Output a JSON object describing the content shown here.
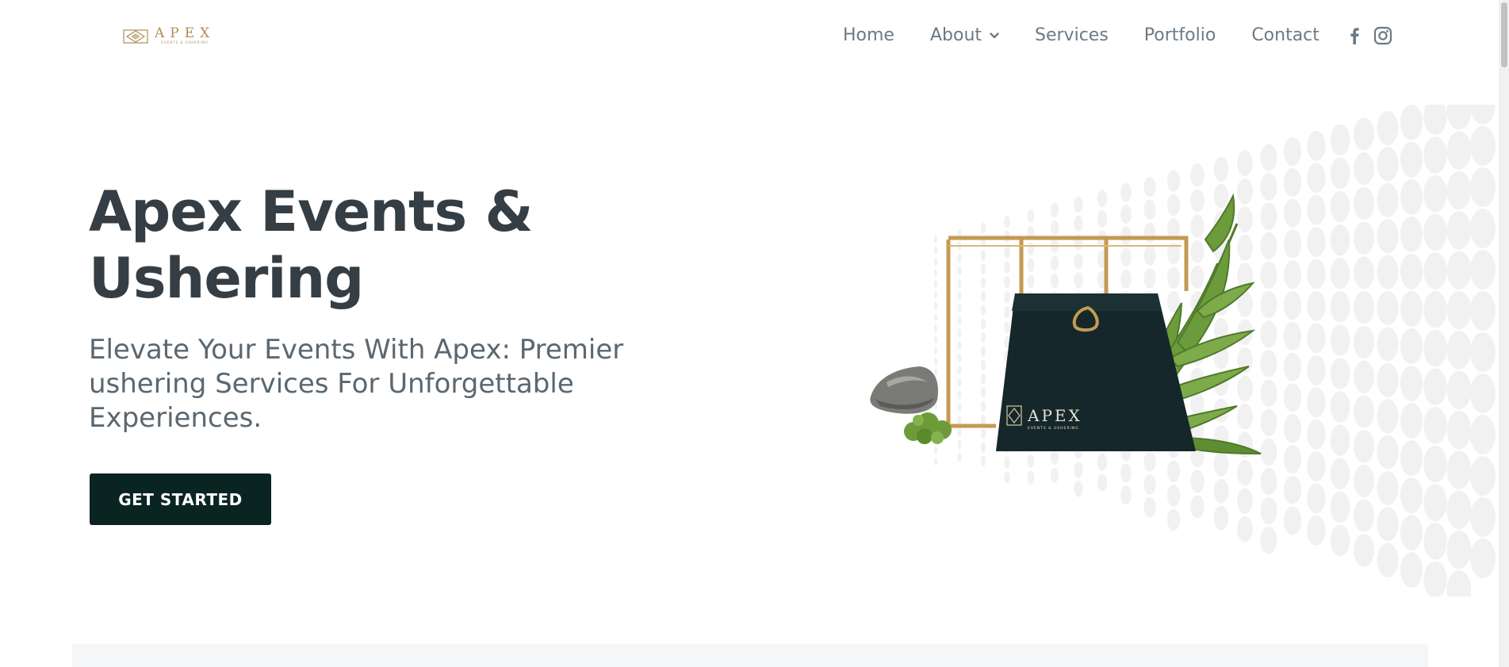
{
  "brand": {
    "logo_word": "APEX",
    "logo_tagline": "EVENTS & USHERING",
    "accent_color": "#b08d57"
  },
  "nav": {
    "items": [
      {
        "label": "Home"
      },
      {
        "label": "About",
        "has_dropdown": true
      },
      {
        "label": "Services"
      },
      {
        "label": "Portfolio"
      },
      {
        "label": "Contact"
      }
    ],
    "social": [
      {
        "icon": "facebook-icon"
      },
      {
        "icon": "instagram-icon"
      }
    ]
  },
  "hero": {
    "title": "Apex Events & Ushering",
    "subtitle": "Elevate Your Events With Apex: Premier ushering Services For Unforgettable Experiences.",
    "cta_label": "GET STARTED",
    "cta_color": "#0a2422"
  },
  "illustration": {
    "bag_brand": "APEX",
    "bag_tagline": "EVENTS & USHERING"
  }
}
